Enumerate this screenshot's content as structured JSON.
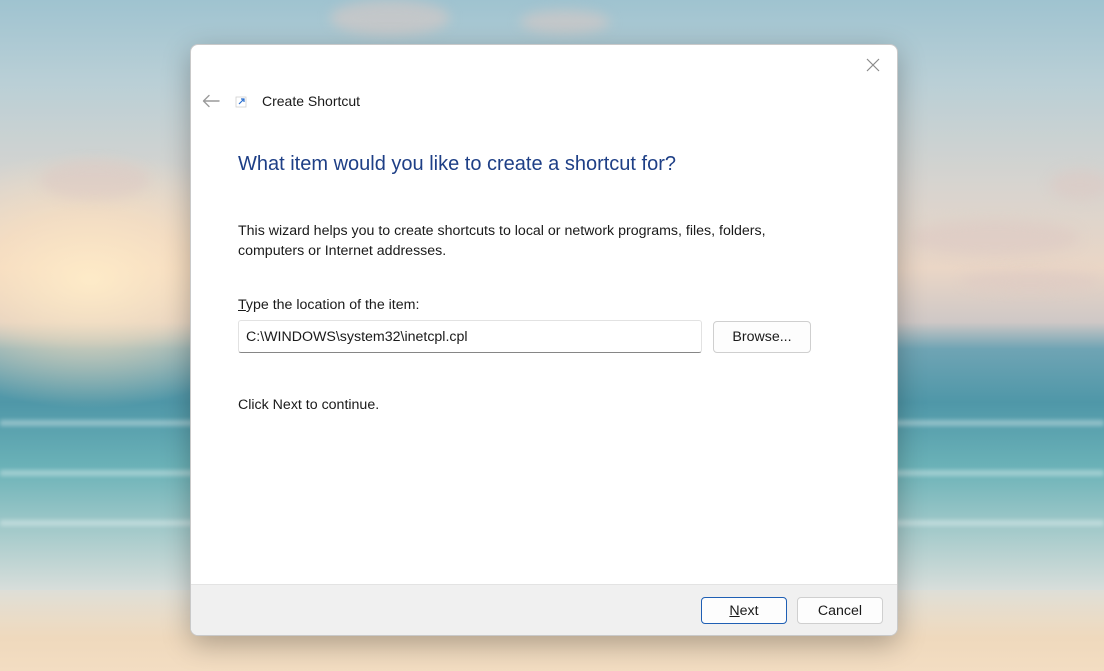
{
  "window": {
    "title": "Create Shortcut",
    "close_icon": "close-icon",
    "back_icon": "arrow-left-icon",
    "app_icon": "shortcut-arrow-icon"
  },
  "wizard": {
    "heading": "What item would you like to create a shortcut for?",
    "description": "This wizard helps you to create shortcuts to local or network programs, files, folders, computers or Internet addresses.",
    "location_label_accel": "T",
    "location_label_rest": "ype the location of the item:",
    "location_value": "C:\\WINDOWS\\system32\\inetcpl.cpl",
    "browse_label": "Browse...",
    "continue_text": "Click Next to continue."
  },
  "footer": {
    "next_accel": "N",
    "next_rest": "ext",
    "cancel_label": "Cancel"
  },
  "colors": {
    "heading": "#1e3f86",
    "default_button_border": "#1f5fb4",
    "footer_bg": "#f0f0f0"
  }
}
